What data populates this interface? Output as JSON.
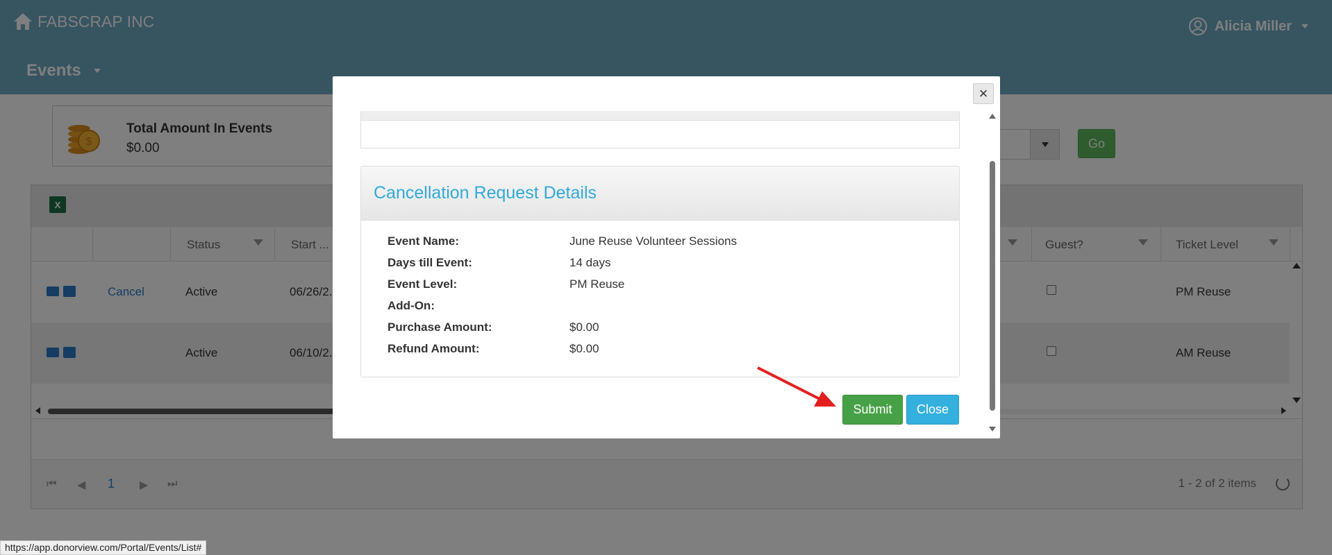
{
  "header": {
    "brand": "FABSCRAP INC",
    "user_name": "Alicia Miller",
    "section_title": "Events"
  },
  "summary": {
    "label": "Total Amount In Events",
    "value": "$0.00"
  },
  "filter": {
    "go_label": "Go"
  },
  "grid": {
    "columns": [
      "Status",
      "Start ...",
      "Guest?",
      "Ticket Level"
    ],
    "rows": [
      {
        "action": "Cancel",
        "status": "Active",
        "start": "06/26/2...",
        "ticket_level": "PM Reuse"
      },
      {
        "action": "",
        "status": "Active",
        "start": "06/10/2...",
        "ticket_level": "AM Reuse"
      }
    ],
    "page": "1",
    "items_info": "1 - 2 of 2 items"
  },
  "modal": {
    "close_symbol": "×",
    "panel_title": "Cancellation Request Details",
    "details": [
      {
        "label": "Event Name:",
        "value": "June Reuse Volunteer Sessions"
      },
      {
        "label": "Days till Event:",
        "value": "14 days"
      },
      {
        "label": "Event Level:",
        "value": "PM Reuse"
      },
      {
        "label": "Add-On:",
        "value": ""
      },
      {
        "label": "Purchase Amount:",
        "value": "$0.00"
      },
      {
        "label": "Refund Amount:",
        "value": "$0.00"
      }
    ],
    "submit_label": "Submit",
    "close_label": "Close"
  },
  "status_url": "https://app.donorview.com/Portal/Events/List#",
  "colors": {
    "header_bg": "#6fa9c2",
    "submit": "#46a146",
    "close": "#34b0de",
    "title": "#31a9d9",
    "arrow": "#e3201f"
  }
}
